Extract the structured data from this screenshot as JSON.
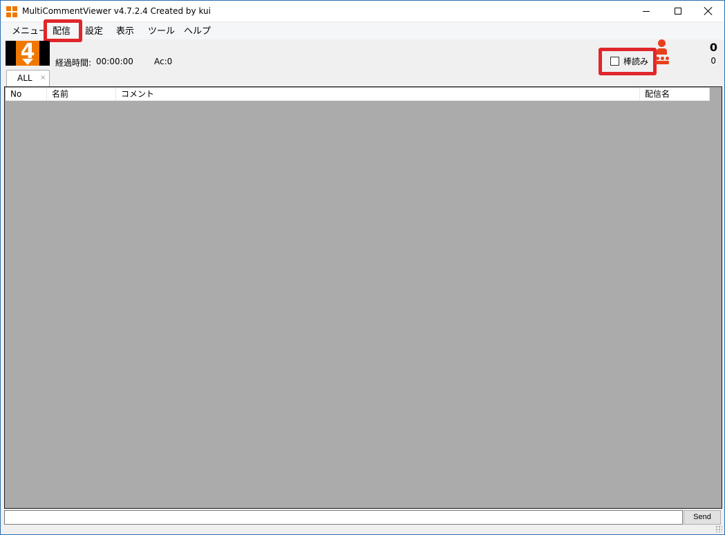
{
  "window": {
    "title": "MultiCommentViewer v4.7.2.4 Created by kui"
  },
  "menu": {
    "items": [
      "メニュー",
      "配信",
      "設定",
      "表示",
      "ツール",
      "ヘルプ"
    ]
  },
  "info": {
    "elapsed_label": "経過時間:",
    "elapsed_value": "00:00:00",
    "ac_label": "Ac:0",
    "bouyomi_label": "棒読み",
    "bouyomi_checked": false,
    "count_big": "0",
    "count_small": "0"
  },
  "tabs": [
    {
      "label": "ALL",
      "close": "×"
    }
  ],
  "list": {
    "columns": [
      "No",
      "名前",
      "コメント",
      "配信名"
    ],
    "rows": []
  },
  "input": {
    "value": "",
    "send_label": "Send"
  },
  "colors": {
    "highlight": "#e0262a",
    "accent": "#f07800",
    "viewer_icon": "#e8401c",
    "list_bg": "#ababab"
  }
}
